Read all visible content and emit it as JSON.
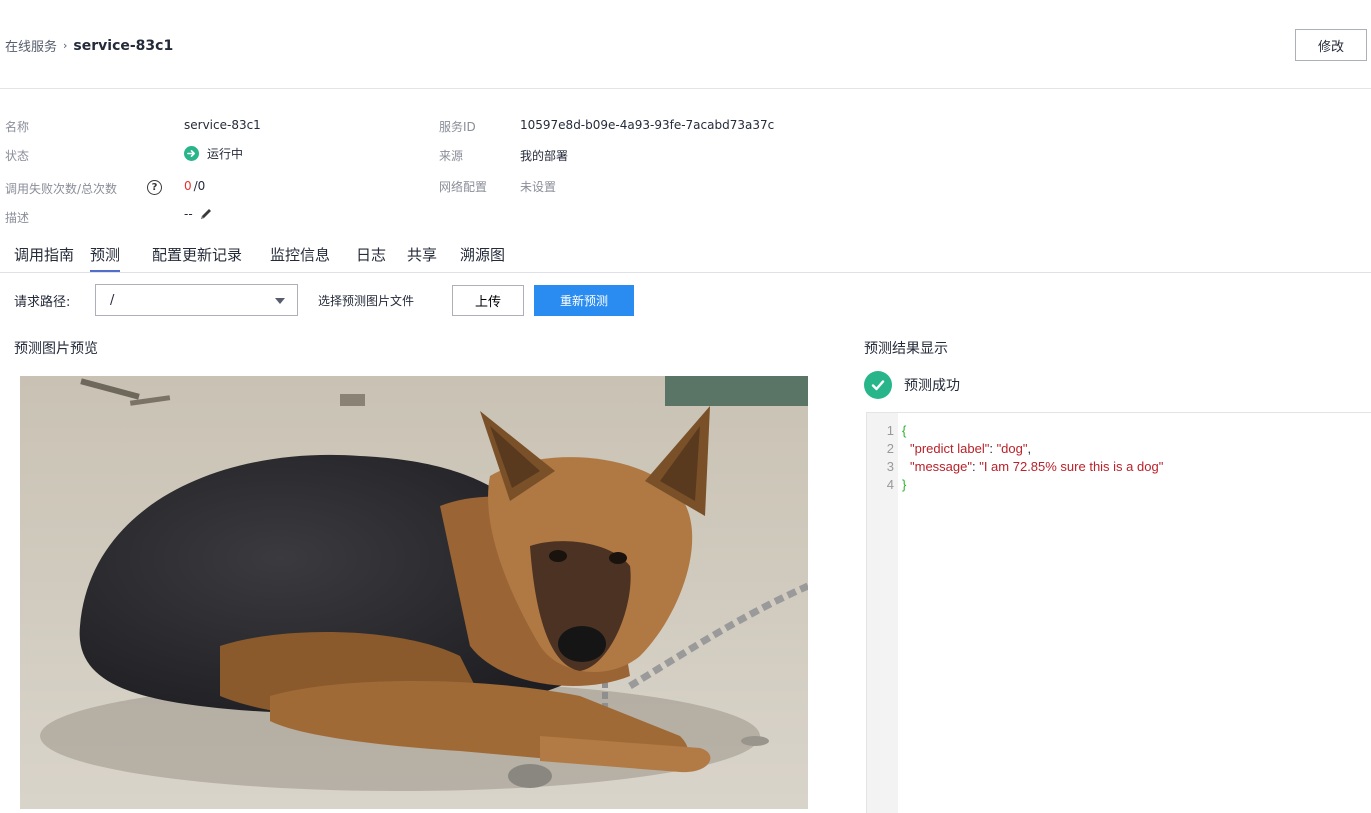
{
  "breadcrumb": {
    "root": "在线服务",
    "separator": "›",
    "current": "service-83c1"
  },
  "header": {
    "edit_label": "修改"
  },
  "info": {
    "name_label": "名称",
    "name_value": "service-83c1",
    "status_label": "状态",
    "status_value": "运行中",
    "calls_label": "调用失败次数/总次数",
    "calls_failed": "0",
    "calls_total": "/0",
    "desc_label": "描述",
    "desc_value": "--",
    "service_id_label": "服务ID",
    "service_id_value": "10597e8d-b09e-4a93-93fe-7acabd73a37c",
    "source_label": "来源",
    "source_value": "我的部署",
    "network_label": "网络配置",
    "network_value": "未设置"
  },
  "tabs": [
    {
      "label": "调用指南",
      "active": false
    },
    {
      "label": "预测",
      "active": true
    },
    {
      "label": "配置更新记录",
      "active": false
    },
    {
      "label": "监控信息",
      "active": false
    },
    {
      "label": "日志",
      "active": false
    },
    {
      "label": "共享",
      "active": false
    },
    {
      "label": "溯源图",
      "active": false
    }
  ],
  "toolbar": {
    "path_label": "请求路径:",
    "path_value": "/",
    "file_label": "选择预测图片文件",
    "upload_label": "上传",
    "repredict_label": "重新预测"
  },
  "preview": {
    "title": "预测图片预览"
  },
  "result": {
    "title": "预测结果显示",
    "status": "预测成功",
    "lines": [
      {
        "num": "1",
        "open": "{"
      },
      {
        "num": "2",
        "key": "\"predict label\"",
        "colon": ": ",
        "value": "\"dog\"",
        "comma": ","
      },
      {
        "num": "3",
        "key": "\"message\"",
        "colon": ": ",
        "value": "\"I am 72.85% sure this is a dog\""
      },
      {
        "num": "4",
        "close": "}"
      }
    ]
  },
  "colors": {
    "primary": "#2a8cf0",
    "success": "#29b58a",
    "error": "#e5322d",
    "tab_active": "#526ecc",
    "json_string": "#b8222a",
    "json_brace": "#2bb42b"
  }
}
